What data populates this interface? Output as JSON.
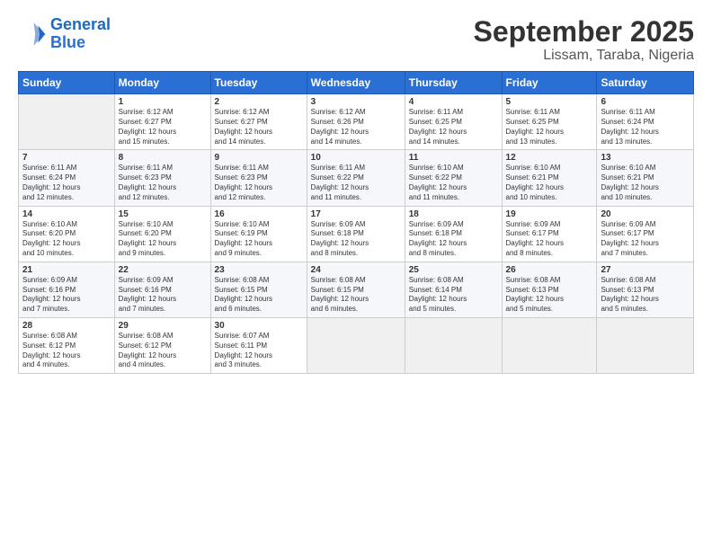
{
  "header": {
    "logo_line1": "General",
    "logo_line2": "Blue",
    "title": "September 2025",
    "subtitle": "Lissam, Taraba, Nigeria"
  },
  "days_of_week": [
    "Sunday",
    "Monday",
    "Tuesday",
    "Wednesday",
    "Thursday",
    "Friday",
    "Saturday"
  ],
  "weeks": [
    [
      {
        "day": "",
        "info": ""
      },
      {
        "day": "1",
        "info": "Sunrise: 6:12 AM\nSunset: 6:27 PM\nDaylight: 12 hours\nand 15 minutes."
      },
      {
        "day": "2",
        "info": "Sunrise: 6:12 AM\nSunset: 6:27 PM\nDaylight: 12 hours\nand 14 minutes."
      },
      {
        "day": "3",
        "info": "Sunrise: 6:12 AM\nSunset: 6:26 PM\nDaylight: 12 hours\nand 14 minutes."
      },
      {
        "day": "4",
        "info": "Sunrise: 6:11 AM\nSunset: 6:25 PM\nDaylight: 12 hours\nand 14 minutes."
      },
      {
        "day": "5",
        "info": "Sunrise: 6:11 AM\nSunset: 6:25 PM\nDaylight: 12 hours\nand 13 minutes."
      },
      {
        "day": "6",
        "info": "Sunrise: 6:11 AM\nSunset: 6:24 PM\nDaylight: 12 hours\nand 13 minutes."
      }
    ],
    [
      {
        "day": "7",
        "info": "Sunrise: 6:11 AM\nSunset: 6:24 PM\nDaylight: 12 hours\nand 12 minutes."
      },
      {
        "day": "8",
        "info": "Sunrise: 6:11 AM\nSunset: 6:23 PM\nDaylight: 12 hours\nand 12 minutes."
      },
      {
        "day": "9",
        "info": "Sunrise: 6:11 AM\nSunset: 6:23 PM\nDaylight: 12 hours\nand 12 minutes."
      },
      {
        "day": "10",
        "info": "Sunrise: 6:11 AM\nSunset: 6:22 PM\nDaylight: 12 hours\nand 11 minutes."
      },
      {
        "day": "11",
        "info": "Sunrise: 6:10 AM\nSunset: 6:22 PM\nDaylight: 12 hours\nand 11 minutes."
      },
      {
        "day": "12",
        "info": "Sunrise: 6:10 AM\nSunset: 6:21 PM\nDaylight: 12 hours\nand 10 minutes."
      },
      {
        "day": "13",
        "info": "Sunrise: 6:10 AM\nSunset: 6:21 PM\nDaylight: 12 hours\nand 10 minutes."
      }
    ],
    [
      {
        "day": "14",
        "info": "Sunrise: 6:10 AM\nSunset: 6:20 PM\nDaylight: 12 hours\nand 10 minutes."
      },
      {
        "day": "15",
        "info": "Sunrise: 6:10 AM\nSunset: 6:20 PM\nDaylight: 12 hours\nand 9 minutes."
      },
      {
        "day": "16",
        "info": "Sunrise: 6:10 AM\nSunset: 6:19 PM\nDaylight: 12 hours\nand 9 minutes."
      },
      {
        "day": "17",
        "info": "Sunrise: 6:09 AM\nSunset: 6:18 PM\nDaylight: 12 hours\nand 8 minutes."
      },
      {
        "day": "18",
        "info": "Sunrise: 6:09 AM\nSunset: 6:18 PM\nDaylight: 12 hours\nand 8 minutes."
      },
      {
        "day": "19",
        "info": "Sunrise: 6:09 AM\nSunset: 6:17 PM\nDaylight: 12 hours\nand 8 minutes."
      },
      {
        "day": "20",
        "info": "Sunrise: 6:09 AM\nSunset: 6:17 PM\nDaylight: 12 hours\nand 7 minutes."
      }
    ],
    [
      {
        "day": "21",
        "info": "Sunrise: 6:09 AM\nSunset: 6:16 PM\nDaylight: 12 hours\nand 7 minutes."
      },
      {
        "day": "22",
        "info": "Sunrise: 6:09 AM\nSunset: 6:16 PM\nDaylight: 12 hours\nand 7 minutes."
      },
      {
        "day": "23",
        "info": "Sunrise: 6:08 AM\nSunset: 6:15 PM\nDaylight: 12 hours\nand 6 minutes."
      },
      {
        "day": "24",
        "info": "Sunrise: 6:08 AM\nSunset: 6:15 PM\nDaylight: 12 hours\nand 6 minutes."
      },
      {
        "day": "25",
        "info": "Sunrise: 6:08 AM\nSunset: 6:14 PM\nDaylight: 12 hours\nand 5 minutes."
      },
      {
        "day": "26",
        "info": "Sunrise: 6:08 AM\nSunset: 6:13 PM\nDaylight: 12 hours\nand 5 minutes."
      },
      {
        "day": "27",
        "info": "Sunrise: 6:08 AM\nSunset: 6:13 PM\nDaylight: 12 hours\nand 5 minutes."
      }
    ],
    [
      {
        "day": "28",
        "info": "Sunrise: 6:08 AM\nSunset: 6:12 PM\nDaylight: 12 hours\nand 4 minutes."
      },
      {
        "day": "29",
        "info": "Sunrise: 6:08 AM\nSunset: 6:12 PM\nDaylight: 12 hours\nand 4 minutes."
      },
      {
        "day": "30",
        "info": "Sunrise: 6:07 AM\nSunset: 6:11 PM\nDaylight: 12 hours\nand 3 minutes."
      },
      {
        "day": "",
        "info": ""
      },
      {
        "day": "",
        "info": ""
      },
      {
        "day": "",
        "info": ""
      },
      {
        "day": "",
        "info": ""
      }
    ]
  ]
}
